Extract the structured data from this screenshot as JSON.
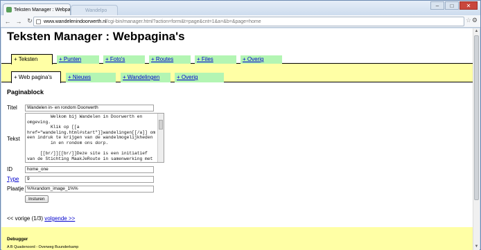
{
  "browser": {
    "tab_title": "Teksten Manager : Webpa",
    "ghost_tab": "Wandelpo",
    "url_host": "www.wandelenindoorwerth.nl",
    "url_path": "/cgi-bin/manager.html?action=form&t=page&cnt=1&a=&b=&page=home",
    "window_buttons": [
      "–",
      "□",
      "✕"
    ]
  },
  "page": {
    "title": "Teksten Manager : Webpagina's"
  },
  "main_tabs": [
    {
      "label": "+ Teksten",
      "active": true
    },
    {
      "label": "+ Punten",
      "active": false
    },
    {
      "label": "+ Foto's",
      "active": false
    },
    {
      "label": "+ Routes",
      "active": false
    },
    {
      "label": "+ Files",
      "active": false
    },
    {
      "label": "+ Overig",
      "active": false
    }
  ],
  "sub_tabs": [
    {
      "label": "+ Web pagina's",
      "active": true
    },
    {
      "label": "+ Nieuws",
      "active": false
    },
    {
      "label": "+ Wandelingen",
      "active": false
    },
    {
      "label": "+ Overig",
      "active": false
    }
  ],
  "form": {
    "section_title": "Paginablock",
    "titel_label": "Titel",
    "titel_value": "Wandelen in- en rondom Doorwerth",
    "tekst_label": "Tekst",
    "tekst_value": "         Welkom bij Wandelen in Doorwerth en\nomgeving.\n         Klik op [[a\nhref=\"wandeling.html#start\"]]wandelingen[[/a]] om\neen indruk te krijgen van de wandelmogelijkheden\n         in en rondom ons dorp.\n\n     [[br/]][[br/]]Deze site is een initiatief\nvan de Stichting MaakJeRoute in samenwerking met",
    "id_label": "ID",
    "id_value": "home_one",
    "type_label": "Type",
    "type_value": "9",
    "plaatje_label": "Plaatje",
    "plaatje_value": "%%random_image_1%%",
    "submit_label": "Insturen"
  },
  "pager": {
    "prev_text": "<< vorige (1/3)",
    "next_text": "volgende >>"
  },
  "debug": {
    "title": "Debugger",
    "line": "A B Quadenoord - Overweg Buunderkamp"
  }
}
